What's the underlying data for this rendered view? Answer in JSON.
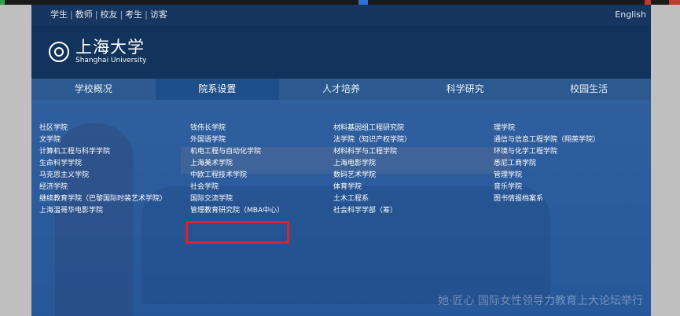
{
  "topbar": {
    "links": [
      "学生",
      "教师",
      "校友",
      "考生",
      "访客"
    ],
    "separator": "|",
    "language": "English"
  },
  "logo": {
    "chinese": "上海大学",
    "english": "Shanghai University"
  },
  "nav": {
    "items": [
      "学校概况",
      "院系设置",
      "人才培养",
      "科学研究",
      "校园生活"
    ],
    "active_index": 1
  },
  "dropdown": {
    "columns": [
      [
        "社区学院",
        "文学院",
        "计算机工程与科学学院",
        "生命科学学院",
        "马克思主义学院",
        "经济学院",
        "继续教育学院（巴黎国际时装艺术学院）",
        "上海温哥华电影学院"
      ],
      [
        "钱伟长学院",
        "外国语学院",
        "机电工程与自动化学院",
        "上海美术学院",
        "中欧工程技术学院",
        "社会学院",
        "国际交流学院",
        "管理教育研究院（MBA中心）"
      ],
      [
        "材料基因组工程研究院",
        "法学院（知识产权学院）",
        "材料科学与工程学院",
        "上海电影学院",
        "数码艺术学院",
        "体育学院",
        "土木工程系",
        "社会科学学部（筹）"
      ],
      [
        "理学院",
        "通信与信息工程学院（翔英学院）",
        "环境与化学工程学院",
        "悉尼工商学院",
        "管理学院",
        "音乐学院",
        "图书情报档案系"
      ]
    ]
  },
  "background": {
    "caption": "她·匠心 国际女性领导力教育上大论坛举行"
  },
  "colors": {
    "topbar": "#16365f",
    "header": "#12335b",
    "nav": "#2c5a90",
    "highlight": "#e3202a"
  }
}
